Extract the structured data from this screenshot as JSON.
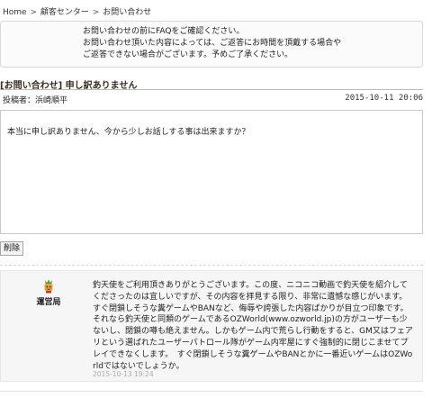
{
  "breadcrumb": {
    "items": [
      "Home",
      "顧客センター",
      "お問い合わせ"
    ],
    "separator": ">"
  },
  "notice": {
    "line1": "お問い合わせの前にFAQをご確認ください。",
    "line2": "お問い合わせ頂いた内容によっては、ご返答にお時間を頂戴する場合や",
    "line3": "ご返答できない場合がございます。予めご了承ください。"
  },
  "inquiry": {
    "title": "[お問い合わせ] 申し訳ありません",
    "author_label": "投稿者：",
    "author": "浜崎順平",
    "date": "2015-10-11 20:06",
    "body": "本当に申し訳ありません、今から少しお話しする事は出来ますか？",
    "delete_label": "削除"
  },
  "reply": {
    "staff_name": "運営局",
    "avatar_icon": "staff-mascot-icon",
    "text": "釣天使をご利用頂きありがとうございます。この度、ニコニコ動画で釣天使を紹介してくださったのは宜しいですが、その内容を拝見する限り、非常に遺憾な感じがいます。すぐ閉鎖しそうな糞ゲームやBANなど、侮辱や誇張した内容ばかりが目立つ印象です。それなら釣天使と同類のゲームであるOZWorld(www.ozworld.jp)の方がユーザーも少ないし、閉鎖の噂も絶えません。しかもゲーム内で荒らし行動をすると、GM又はフェアリという選ばれたユーザーパトロール隊がゲーム内牢屋にすぐ強制的に閉じこませてプレイできなくします。　すぐ閉鎖しそうな糞ゲームやBANとかに一番近いゲームはOZWorldではないでしょうか。",
    "date": "2015-10-13 19:24"
  },
  "colors": {
    "title": "#3a2a1a",
    "reply_bg": "#f6f6f6",
    "reply_date": "#aaaaaa"
  }
}
